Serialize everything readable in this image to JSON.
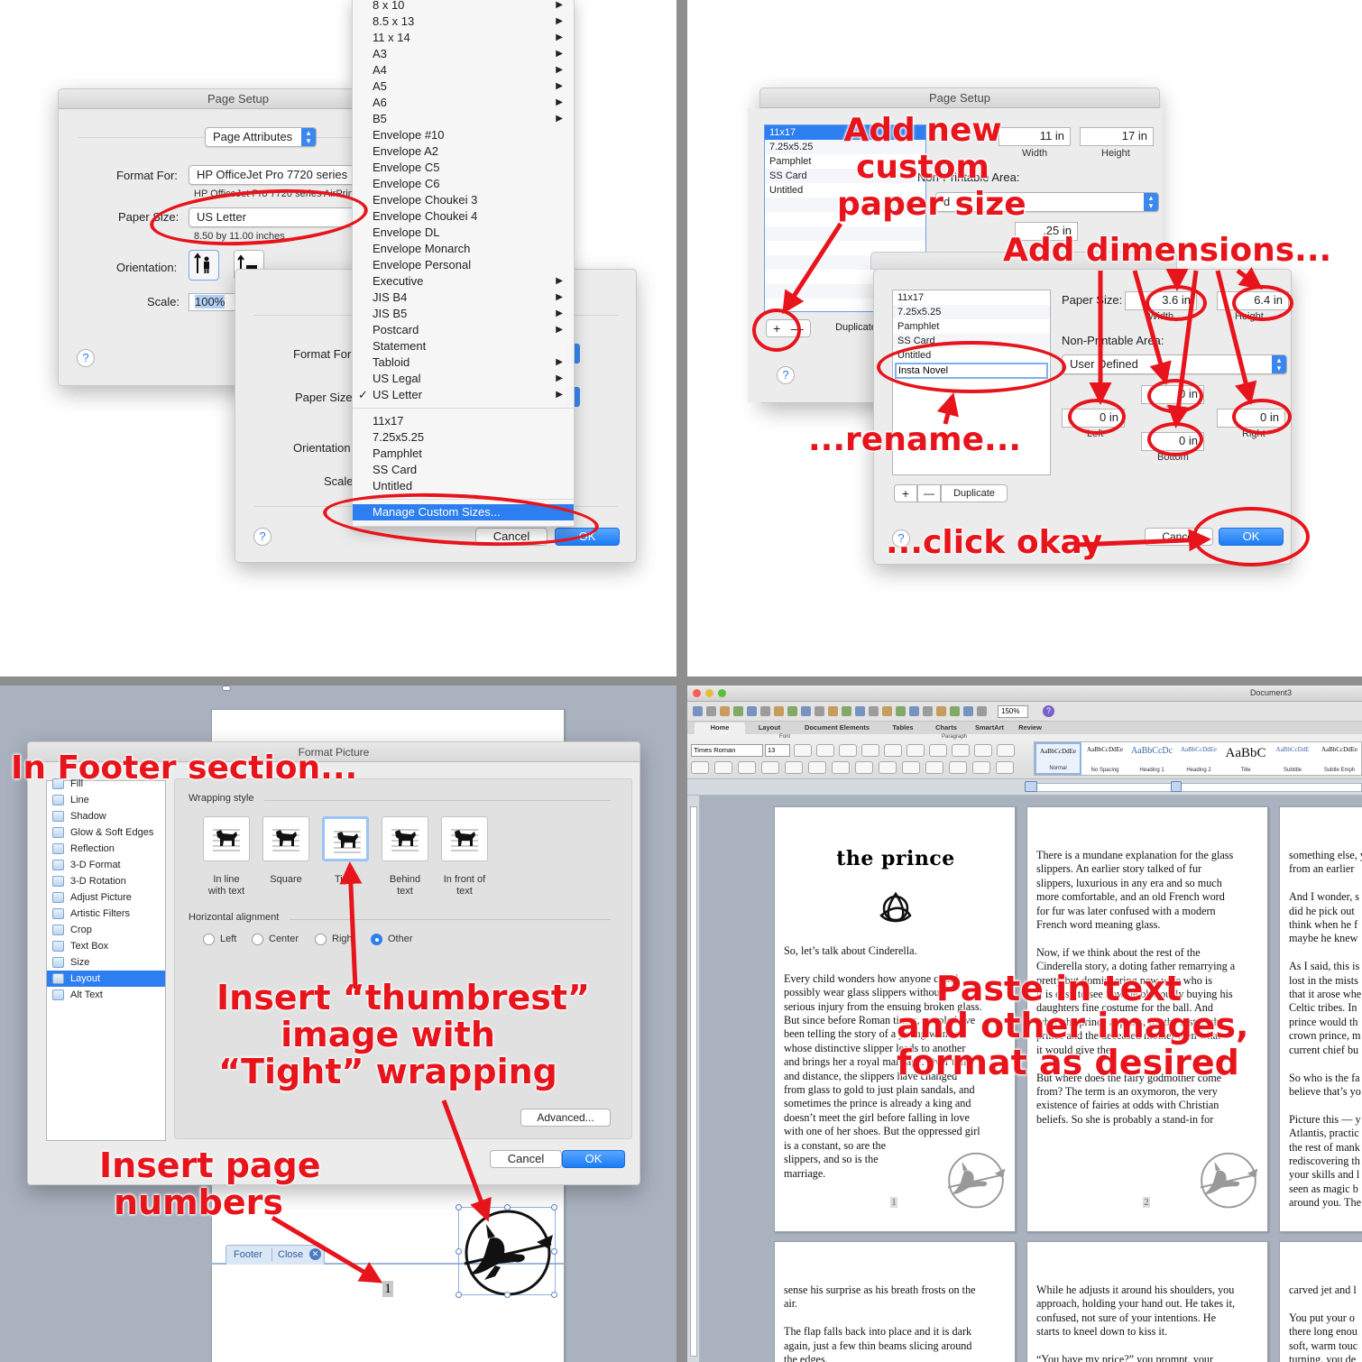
{
  "colors": {
    "annotation_red": "#e8141c",
    "mac_blue": "#2d7ef0",
    "word_bg": "#aab2bf"
  },
  "q1": {
    "page_setup": {
      "title": "Page Setup",
      "settings_popup": "Page Attributes",
      "format_for_label": "Format For:",
      "format_for_value": "HP OfficeJet Pro 7720 series",
      "format_for_sub": "HP OfficeJet Pro 7720 series AirPrint",
      "paper_size_label": "Paper Size:",
      "paper_size_value": "US Letter",
      "paper_size_sub": "8.50 by 11.00 inches",
      "orientation_label": "Orientation:",
      "scale_label": "Scale:",
      "scale_value": "100%",
      "help": "?"
    },
    "page_setup_front": {
      "format_for_label": "Format For",
      "paper_size_label": "Paper Size",
      "orientation_label": "Orientation",
      "scale_label": "Scale",
      "cancel": "Cancel",
      "ok": "OK",
      "help": "?"
    },
    "menu": {
      "items": [
        {
          "label": "8 x 10",
          "sub": "▶"
        },
        {
          "label": "8.5 x 13",
          "sub": "▶"
        },
        {
          "label": "11 x 14",
          "sub": "▶"
        },
        {
          "label": "A3",
          "sub": "▶"
        },
        {
          "label": "A4",
          "sub": "▶"
        },
        {
          "label": "A5",
          "sub": "▶"
        },
        {
          "label": "A6",
          "sub": "▶"
        },
        {
          "label": "B5",
          "sub": "▶"
        },
        {
          "label": "Envelope #10",
          "sub": ""
        },
        {
          "label": "Envelope A2",
          "sub": ""
        },
        {
          "label": "Envelope C5",
          "sub": ""
        },
        {
          "label": "Envelope C6",
          "sub": ""
        },
        {
          "label": "Envelope Choukei 3",
          "sub": ""
        },
        {
          "label": "Envelope Choukei 4",
          "sub": ""
        },
        {
          "label": "Envelope DL",
          "sub": ""
        },
        {
          "label": "Envelope Monarch",
          "sub": ""
        },
        {
          "label": "Envelope Personal",
          "sub": ""
        },
        {
          "label": "Executive",
          "sub": "▶"
        },
        {
          "label": "JIS B4",
          "sub": "▶"
        },
        {
          "label": "JIS B5",
          "sub": "▶"
        },
        {
          "label": "Postcard",
          "sub": "▶"
        },
        {
          "label": "Statement",
          "sub": ""
        },
        {
          "label": "Tabloid",
          "sub": "▶"
        },
        {
          "label": "US Legal",
          "sub": "▶"
        },
        {
          "label": "US Letter",
          "sub": "▶",
          "checked": "✓"
        }
      ],
      "custom_items": [
        "11x17",
        "7.25x5.25",
        "Pamphlet",
        "SS Card",
        "Untitled"
      ],
      "manage": "Manage Custom Sizes..."
    }
  },
  "q2": {
    "back": {
      "title": "Page Setup",
      "list": [
        "11x17",
        "7.25x5.25",
        "Pamphlet",
        "SS Card",
        "Untitled"
      ],
      "colon": ":",
      "width_value": "11 in",
      "height_value": "17 in",
      "width_label": "Width",
      "height_label": "Height",
      "np_label": "Non-Printable Area:",
      "np_value": "d",
      "top_value": ".25 in",
      "duplicate": "Duplicate",
      "help": "?"
    },
    "front": {
      "list": [
        "11x17",
        "7.25x5.25",
        "Pamphlet",
        "SS Card",
        "Untitled"
      ],
      "edit_value": "Insta Novel",
      "paper_size_label": "Paper Size:",
      "width_value": "3.6 in",
      "height_value": "6.4 in",
      "width_label": "Width",
      "height_label": "Height",
      "np_label": "Non-Printable Area:",
      "np_value": "User Defined",
      "top_value": "0 in",
      "left_value": "0 in",
      "right_value": "0 in",
      "bottom_value": "0 in",
      "top_label": "Top",
      "left_label": "Left",
      "right_label": "Right",
      "bottom_label": "Bottom",
      "duplicate": "Duplicate",
      "plus": "+",
      "minus": "—",
      "cancel": "Cancel",
      "ok": "OK",
      "help": "?"
    },
    "annotations": {
      "add_new": "Add new\ncustom\npaper size",
      "add_dims": "Add dimensions...",
      "rename": "...rename...",
      "click_okay": "...click okay"
    }
  },
  "q3": {
    "format_picture": {
      "title": "Format Picture",
      "categories": [
        "Fill",
        "Line",
        "Shadow",
        "Glow & Soft Edges",
        "Reflection",
        "3-D Format",
        "3-D Rotation",
        "Adjust Picture",
        "Artistic Filters",
        "Crop",
        "Text Box",
        "Size",
        "Layout",
        "Alt Text"
      ],
      "selected_category": "Layout",
      "wrapping_label": "Wrapping style",
      "wrap_options": [
        "In line\nwith text",
        "Square",
        "Tight",
        "Behind\ntext",
        "In front of\ntext"
      ],
      "halign_label": "Horizontal alignment",
      "halign_options": [
        "Left",
        "Center",
        "Right",
        "Other"
      ],
      "advanced": "Advanced...",
      "cancel": "Cancel",
      "ok": "OK"
    },
    "footer_tab": "Footer",
    "close_tab": "Close",
    "page_number": "1",
    "annotations": {
      "footer": "In Footer section...",
      "thumbrest": "Insert “thumbrest”\nimage with\n“Tight” wrapping",
      "page_numbers": "Insert page\nnumbers"
    }
  },
  "q4": {
    "doc_title": "Document3",
    "zoom": "150%",
    "tabs": [
      "Home",
      "Layout",
      "Document Elements",
      "Tables",
      "Charts",
      "SmartArt",
      "Review"
    ],
    "group_font": "Font",
    "group_paragraph": "Paragraph",
    "font_name": "Times Roman",
    "font_size": "13",
    "styles": [
      {
        "sample": "AaBbCcDdEe",
        "name": "Normal"
      },
      {
        "sample": "AaBbCcDdEe",
        "name": "No Spacing"
      },
      {
        "sample": "AaBbCcDc",
        "name": "Heading 1"
      },
      {
        "sample": "AaBbCcDdEe",
        "name": "Heading 2"
      },
      {
        "sample": "AaBbC",
        "name": "Title"
      },
      {
        "sample": "AaBbCcDdE",
        "name": "Subtitle"
      },
      {
        "sample": "AaBbCcDdEe",
        "name": "Subtle Emph"
      }
    ],
    "page1": {
      "heading": "the prince",
      "text": "So, let’s talk about Cinderella.\n\nEvery child wonders how anyone could\npossibly wear glass slippers without\nserious injury from the ensuing broken glass.\nBut since before Roman times, people have\nbeen telling the story of a young woman\nwhose distinctive slipper leads to another\nand brings her a royal marriage. Over time\nand distance, the slippers have changed\nfrom glass to gold to just plain sandals, and\nsometimes the prince is already a king and\ndoesn’t meet the girl before falling in love\nwith one of her shoes. But the oppressed girl\nis a constant, so are the\nslippers, and so is the\nmarriage.",
      "number": "1"
    },
    "page2": {
      "text": "There is a mundane explanation for the glass\nslippers. An earlier story talked of fur\nslippers, luxurious in any era and so much\nmore comfortable, and an old French word\nfor fur was later confused with a modern\nFrench word meaning glass.\n\nNow, if we think about the rest of the\nCinderella story, a doting father remarrying a\npretty but domineering new wife who is\nit is easy to see how he obviously buying his\ndaughters fine costume for the ball. And\nwhen the prince appears, for the rest of the\nprince and the deceased mother then what\nit would give the\n\nBut where does the fairy godmother come\nfrom? The term is an oxymoron, the very\nexistence of fairies at odds with Christian\nbeliefs. So she is probably a stand-in for",
      "number": "2"
    },
    "page3": {
      "text": "something else, y\nfrom an earlier\n\nAnd I wonder, s\ndid he pick out\nthink when he f\nmaybe he knew\n\nAs I said, this is\nlost in the mists\nthat it arose whe\nCeltic tribes. In\nprince would th\ncrown prince, m\ncurrent chief bu\n\nSo who is the fa\nbelieve that’s yo\n\nPicture this — y\nAtlantis, practic\nthe rest of mank\nrediscovering th\nyour skills and l\nseen as magic b\naround you. The"
    },
    "page4": {
      "text": "sense his surprise as his breath frosts on the\nair.\n\nThe flap falls back into place and it is dark\nagain, just a few thin beams slicing around\nthe edges."
    },
    "page5": {
      "text": "While he adjusts it around his shoulders, you\napproach, holding your hand out. He takes it,\nconfused, not sure of your intentions. He\nstarts to kneel down to kiss it.\n\n“You have my price?” you prompt, your"
    },
    "page6": {
      "text": "carved jet and l\n\nYou put your o\nthere long enou\nsoft, warm touc\nturning, you de"
    },
    "annotation": "Paste in text\nand other images,\nformat as desired"
  }
}
